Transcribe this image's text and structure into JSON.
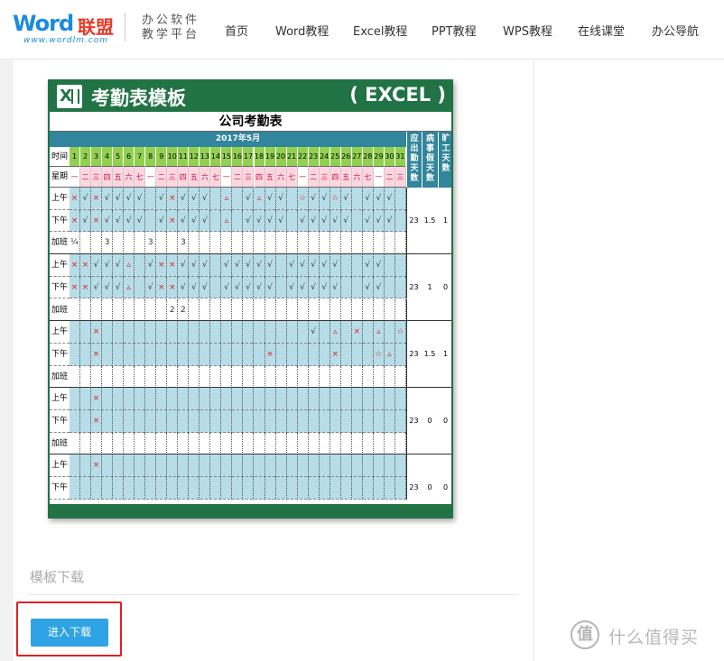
{
  "header": {
    "logo_word": "Word",
    "logo_cn": "联盟",
    "logo_url": "www.wordlm.com",
    "slogan_line1": "办公软件",
    "slogan_line2": "教学平台",
    "nav": [
      "首页",
      "Word教程",
      "Excel教程",
      "PPT教程",
      "WPS教程",
      "在线课堂",
      "办公导航"
    ]
  },
  "preview": {
    "banner_title": "考勤表模板",
    "banner_tag": "( EXCEL )",
    "sheet_title": "公司考勤表",
    "month_label": "2017年5月",
    "time_label": "时间",
    "week_label": "星期",
    "days": [
      "1",
      "2",
      "3",
      "4",
      "5",
      "6",
      "7",
      "8",
      "9",
      "10",
      "11",
      "12",
      "13",
      "14",
      "15",
      "16",
      "17",
      "18",
      "19",
      "20",
      "21",
      "22",
      "23",
      "24",
      "25",
      "26",
      "27",
      "28",
      "29",
      "30",
      "31"
    ],
    "weekdays": [
      "一",
      "二",
      "三",
      "四",
      "五",
      "六",
      "七",
      "一",
      "二",
      "三",
      "四",
      "五",
      "六",
      "七",
      "一",
      "二",
      "三",
      "四",
      "五",
      "六",
      "七",
      "一",
      "二",
      "三",
      "四",
      "五",
      "六",
      "七",
      "一",
      "二",
      "三"
    ],
    "summary_headers": [
      "应出勤天数",
      "病事假天数",
      "旷工天数"
    ],
    "row_labels": [
      "上午",
      "下午",
      "加班",
      "上午",
      "下午",
      "加班",
      "上午",
      "下午",
      "加班",
      "上午",
      "下午",
      "加班",
      "上午",
      "下午"
    ],
    "group_totals": [
      [
        "23",
        "1.5",
        "1"
      ],
      [
        "23",
        "1",
        "0"
      ],
      [
        "23",
        "1.5",
        "1"
      ],
      [
        "23",
        "0",
        "0"
      ],
      [
        "23",
        "0",
        "0"
      ]
    ],
    "marks": {
      "r0": "×√×√√√√ √×√√√ ▵ √▵√√ ☆√√☆√ √√√",
      "r1": "×√×√√√√ √×√√√ ▵ √√√√ √√√√√ √√√",
      "r2": "¼  3   3  3",
      "r3": "××√√√▵ √××√√√ √√√√√ √√√√√  √√",
      "r4": "××√√√▵ √××√√√ √√√√√ √√√√√  √√",
      "r5": "         22",
      "r6": "  ×                   √ ▵ × ▵ ☆",
      "r7": "  ×               ×     ×   ☆▵",
      "r9": "  ×",
      "r10": "  ×",
      "r12": "  ×"
    }
  },
  "download": {
    "section_title": "模板下载",
    "button_label": "进入下载"
  },
  "watermark": {
    "circle": "值",
    "text": "什么值得买"
  },
  "colors": {
    "excel_green": "#217346",
    "teal_header": "#31859c",
    "weekday_green": "#92d050",
    "weekday_pink": "#ffd6e0",
    "row_blue": "#b7dde8",
    "button_blue": "#2fa3e6",
    "highlight_red": "#e02020"
  }
}
